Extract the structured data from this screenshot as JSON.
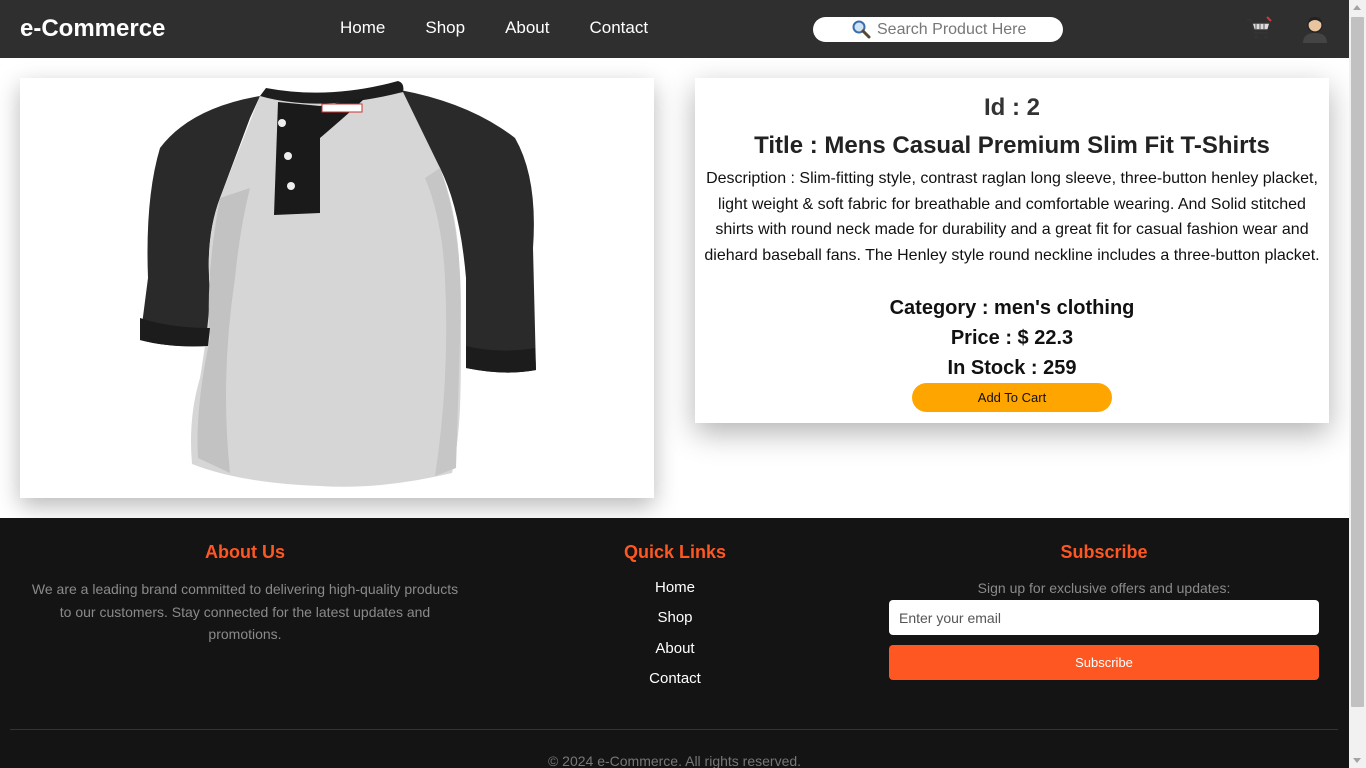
{
  "navbar": {
    "brand": "e-Commerce",
    "links": [
      "Home",
      "Shop",
      "About",
      "Contact"
    ],
    "search_placeholder": "Search Product Here",
    "search_icon": "magnifier-emoji",
    "cart_icon": "shopping-cart",
    "user_icon": "person-avatar"
  },
  "product": {
    "image_alt": "Mens Casual Premium Slim Fit T-Shirts",
    "id_text": "Id : 2",
    "title_text": "Title : Mens Casual Premium Slim Fit T-Shirts",
    "description_text": "Description : Slim-fitting style, contrast raglan long sleeve, three-button henley placket, light weight & soft fabric for breathable and comfortable wearing. And Solid stitched shirts with round neck made for durability and a great fit for casual fashion wear and diehard baseball fans. The Henley style round neckline includes a three-button placket.",
    "category_text": "Category : men's clothing",
    "price_text": "Price : $ 22.3",
    "stock_text": "In Stock : 259",
    "add_to_cart": "Add To Cart"
  },
  "footer": {
    "about": {
      "heading": "About Us",
      "text": "We are a leading brand committed to delivering high-quality products to our customers. Stay connected for the latest updates and promotions."
    },
    "quick_links": {
      "heading": "Quick Links",
      "links": [
        "Home",
        "Shop",
        "About",
        "Contact"
      ]
    },
    "subscribe": {
      "heading": "Subscribe",
      "text": "Sign up for exclusive offers and updates:",
      "email_placeholder": "Enter your email",
      "button": "Subscribe"
    },
    "copyright": "© 2024 e-Commerce. All rights reserved."
  },
  "colors": {
    "navbar_bg": "#2f2f2f",
    "footer_bg": "#141414",
    "accent_orange": "#ff5722",
    "add_to_cart_bg": "#ffa500"
  }
}
